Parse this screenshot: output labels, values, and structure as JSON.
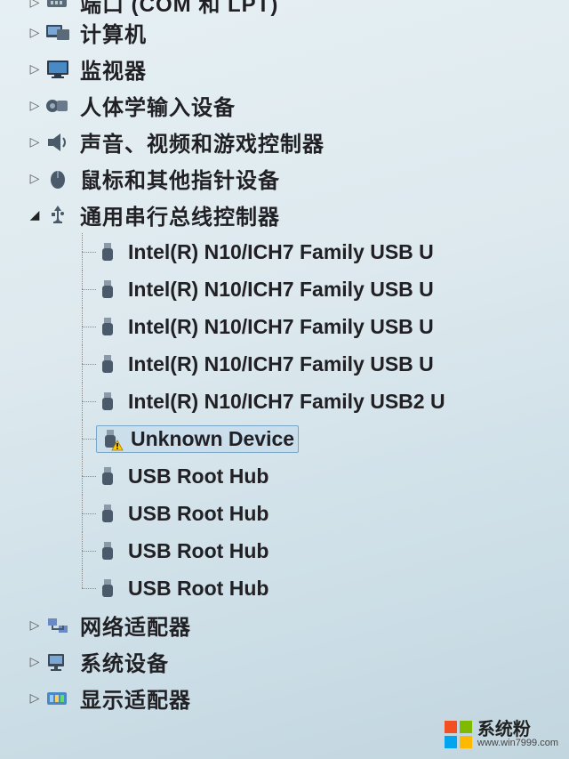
{
  "categories": [
    {
      "key": "ports",
      "label": "端口 (COM 和 LPT)",
      "icon": "port",
      "expanded": false,
      "partial": true
    },
    {
      "key": "computer",
      "label": "计算机",
      "icon": "computer",
      "expanded": false
    },
    {
      "key": "monitor",
      "label": "监视器",
      "icon": "monitor",
      "expanded": false
    },
    {
      "key": "hid",
      "label": "人体学输入设备",
      "icon": "hid",
      "expanded": false
    },
    {
      "key": "sound",
      "label": "声音、视频和游戏控制器",
      "icon": "sound",
      "expanded": false
    },
    {
      "key": "mouse",
      "label": "鼠标和其他指针设备",
      "icon": "mouse",
      "expanded": false
    },
    {
      "key": "usb",
      "label": "通用串行总线控制器",
      "icon": "usb",
      "expanded": true,
      "children": [
        {
          "label": "Intel(R) N10/ICH7 Family USB U",
          "icon": "usb-plug",
          "warning": false
        },
        {
          "label": "Intel(R) N10/ICH7 Family USB U",
          "icon": "usb-plug",
          "warning": false
        },
        {
          "label": "Intel(R) N10/ICH7 Family USB U",
          "icon": "usb-plug",
          "warning": false
        },
        {
          "label": "Intel(R) N10/ICH7 Family USB U",
          "icon": "usb-plug",
          "warning": false
        },
        {
          "label": "Intel(R) N10/ICH7 Family USB2 U",
          "icon": "usb-plug",
          "warning": false
        },
        {
          "label": "Unknown Device",
          "icon": "usb-plug",
          "warning": true,
          "selected": true
        },
        {
          "label": "USB Root Hub",
          "icon": "usb-plug",
          "warning": false
        },
        {
          "label": "USB Root Hub",
          "icon": "usb-plug",
          "warning": false
        },
        {
          "label": "USB Root Hub",
          "icon": "usb-plug",
          "warning": false
        },
        {
          "label": "USB Root Hub",
          "icon": "usb-plug",
          "warning": false
        }
      ]
    },
    {
      "key": "network",
      "label": "网络适配器",
      "icon": "network",
      "expanded": false
    },
    {
      "key": "system",
      "label": "系统设备",
      "icon": "system",
      "expanded": false
    },
    {
      "key": "display",
      "label": "显示适配器",
      "icon": "display",
      "expanded": false
    }
  ],
  "watermark": {
    "main": "系统粉",
    "sub": "www.win7999.com"
  }
}
